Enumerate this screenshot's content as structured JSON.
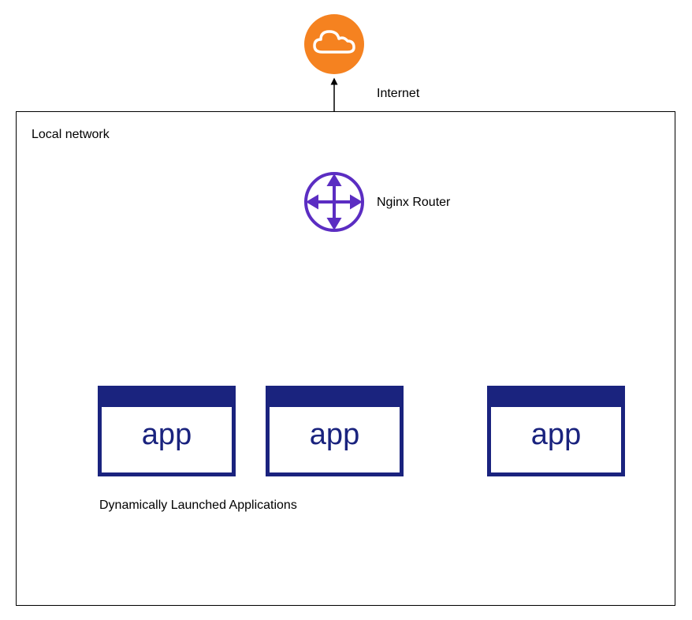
{
  "labels": {
    "internet": "Internet",
    "local_network": "Local network",
    "router": "Nginx Router",
    "apps_caption": "Dynamically Launched Applications"
  },
  "apps": {
    "app1_label": "app",
    "app2_label": "app",
    "app3_label": "app"
  },
  "colors": {
    "cloud_fill": "#f58220",
    "router_stroke": "#5b2dc2",
    "app_border": "#1a237e",
    "line": "#000000"
  }
}
